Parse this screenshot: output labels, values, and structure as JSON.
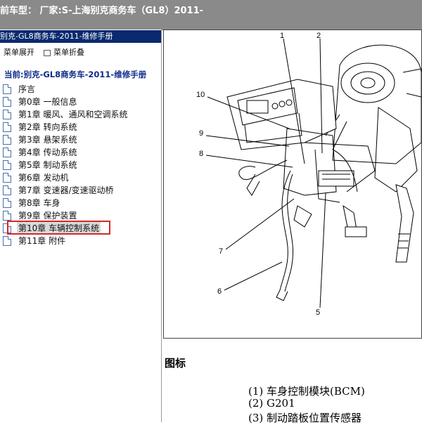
{
  "header": {
    "title": "前车型：  厂家:S-上海别克商务车（GL8）2011-"
  },
  "left_panel": {
    "header": "别克-GL8商务车-2011-维修手册",
    "toolbar": {
      "expand": "菜单展开",
      "collapse": "菜单折叠"
    },
    "current_label": "当前:别克-GL8商务车-2011-维修手册",
    "tree_items": [
      "序言",
      "第0章 一般信息",
      "第1章 暖风、通风和空调系统",
      "第2章 转向系统",
      "第3章 悬架系统",
      "第4章 传动系统",
      "第5章 制动系统",
      "第6章 发动机",
      "第7章 变速器/变速驱动桥",
      "第8章 车身",
      "第9章 保护装置",
      "第10章 车辆控制系统",
      "第11章 附件"
    ],
    "selected_index": 11
  },
  "diagram": {
    "callouts": [
      "1",
      "2",
      "10",
      "9",
      "8",
      "7",
      "6",
      "5"
    ]
  },
  "legend": {
    "title": "图标",
    "items": [
      "(1) 车身控制模块(BCM)",
      "(2) G201",
      "(3) 制动踏板位置传感器"
    ]
  },
  "colors": {
    "topbar": "#8a8a8a",
    "panel_header": "#0a2a6f",
    "highlight": "#d62828"
  }
}
